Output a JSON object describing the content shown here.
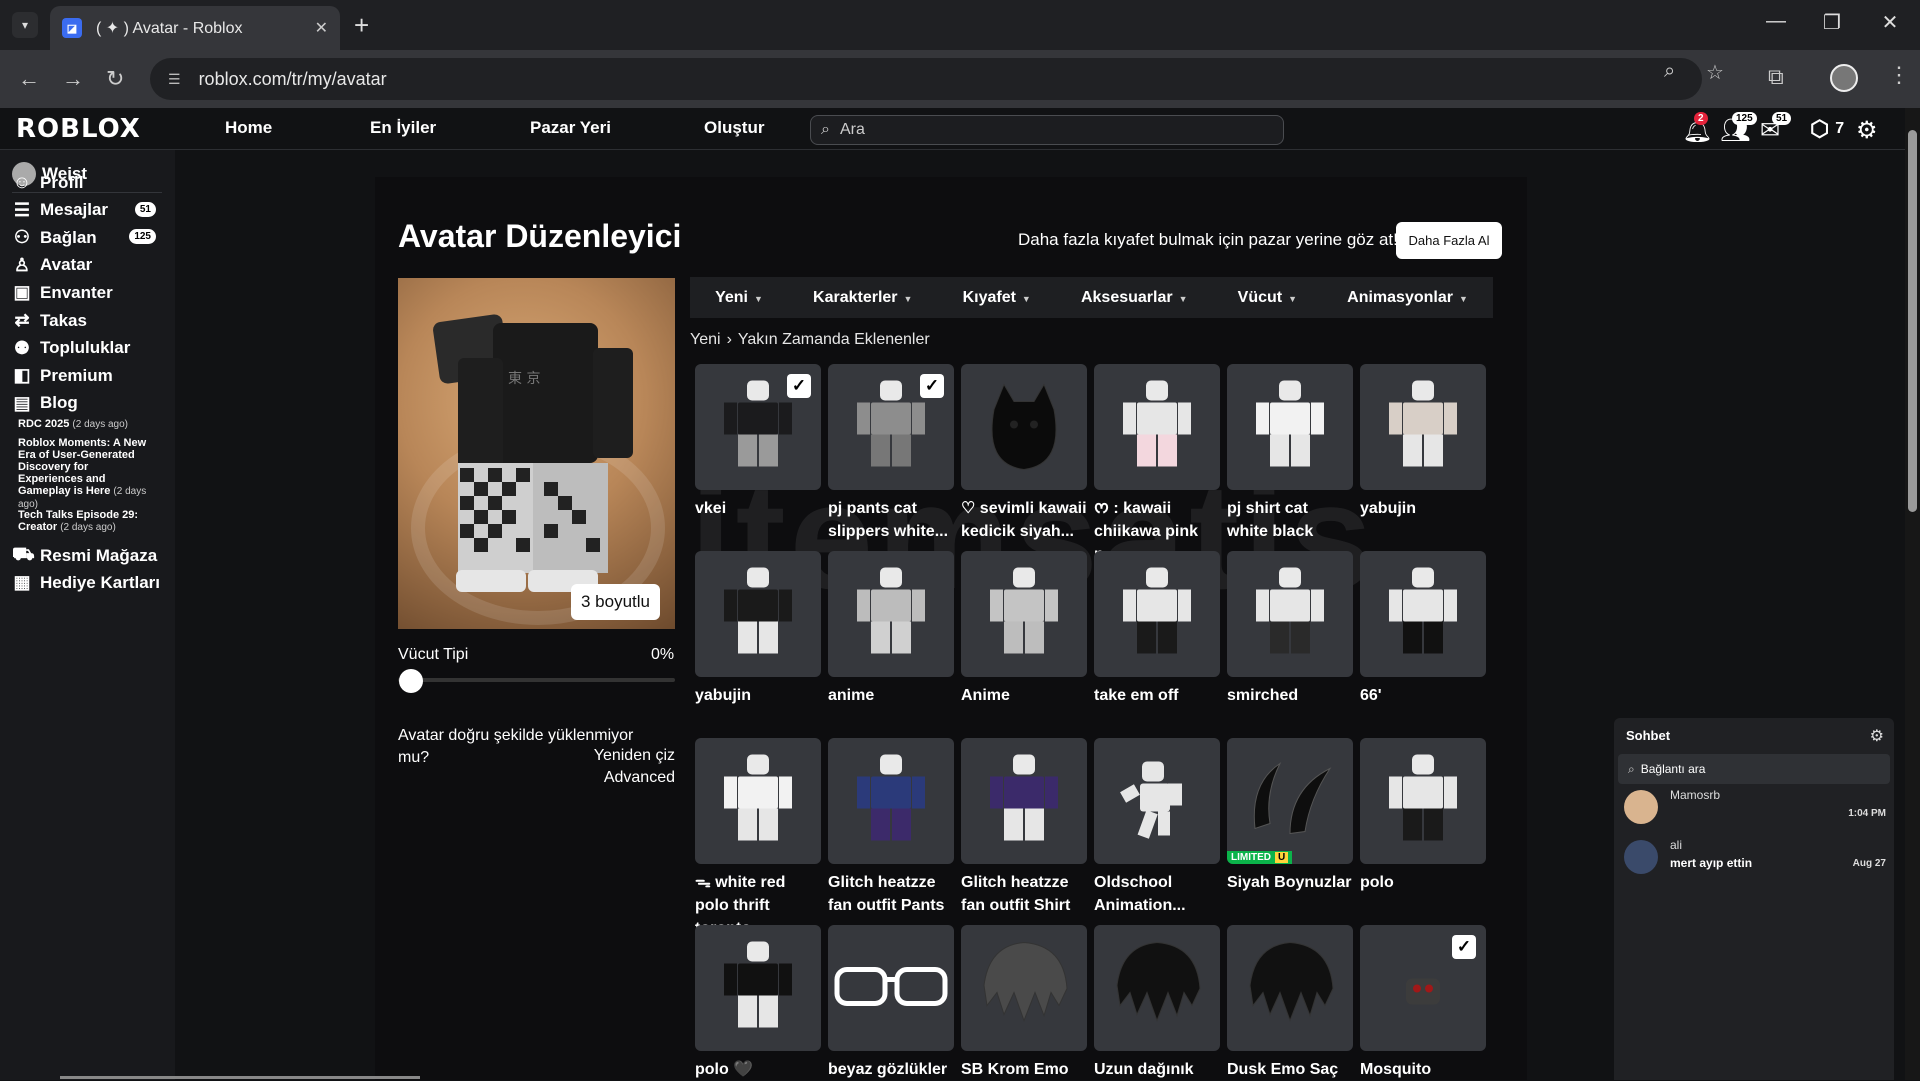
{
  "browser": {
    "tab_title": "( ✦ ) Avatar - Roblox",
    "url": "roblox.com/tr/my/avatar"
  },
  "header": {
    "logo": "ROBLOX",
    "nav": [
      "Home",
      "En İyiler",
      "Pazar Yeri",
      "Oluştur"
    ],
    "search_placeholder": "Ara",
    "notif_badge": "2",
    "friends_badge": "125",
    "messages_badge": "51",
    "robux": "7"
  },
  "sidebar": {
    "username": "Weist",
    "items": [
      {
        "label": "Profil",
        "icon": "person-icon",
        "badge": ""
      },
      {
        "label": "Mesajlar",
        "icon": "messages-icon",
        "badge": "51"
      },
      {
        "label": "Bağlan",
        "icon": "friends-icon",
        "badge": "125"
      },
      {
        "label": "Avatar",
        "icon": "avatar-icon",
        "badge": ""
      },
      {
        "label": "Envanter",
        "icon": "inventory-icon",
        "badge": ""
      },
      {
        "label": "Takas",
        "icon": "trade-icon",
        "badge": ""
      },
      {
        "label": "Topluluklar",
        "icon": "groups-icon",
        "badge": ""
      },
      {
        "label": "Premium",
        "icon": "premium-icon",
        "badge": ""
      },
      {
        "label": "Blog",
        "icon": "blog-icon",
        "badge": ""
      }
    ],
    "blog_posts": [
      {
        "title": "RDC 2025",
        "ago": "(2 days ago)"
      },
      {
        "title": "Roblox Moments: A New Era of User-Generated Discovery for Experiences and Gameplay is Here",
        "ago": "(2 days ago)"
      },
      {
        "title": "Tech Talks Episode 29: Creator",
        "ago": "(2 days ago)"
      }
    ],
    "bottom_items": [
      {
        "label": "Resmi Mağaza",
        "icon": "cart-icon"
      },
      {
        "label": "Hediye Kartları",
        "icon": "gift-card-icon"
      }
    ]
  },
  "editor": {
    "title": "Avatar Düzenleyici",
    "promo": "Daha fazla kıyafet bulmak için pazar yerine göz at!",
    "more_button": "Daha Fazla Al",
    "view_3d_button": "3 boyutlu",
    "body_type_label": "Vücut Tipi",
    "body_type_value": "0%",
    "body_type_level": 0,
    "help_text": "Avatar doğru şekilde yüklenmiyor mu?",
    "redraw": "Yeniden çiz",
    "advanced": "Advanced",
    "tabs": [
      "Yeni",
      "Karakterler",
      "Kıyafet",
      "Aksesuarlar",
      "Vücut",
      "Animasyonlar"
    ],
    "breadcrumb": [
      "Yeni",
      "Yakın Zamanda Eklenenler"
    ],
    "items": [
      {
        "name": "vkei",
        "checked": true,
        "kind": "fig",
        "top": "#1b1b1d",
        "bottom": "#9a9a9a"
      },
      {
        "name": "pj pants cat slippers white...",
        "checked": true,
        "kind": "fig",
        "top": "#8d8d8d",
        "bottom": "#777"
      },
      {
        "name": "♡ sevimli kawaii kedicik siyah...",
        "checked": false,
        "kind": "bag",
        "top": "#111",
        "bottom": "#111"
      },
      {
        "name": "ᰔ : kawaii chiikawa pink p...",
        "checked": false,
        "kind": "fig",
        "top": "#e6e6e6",
        "bottom": "#f3d7de"
      },
      {
        "name": "pj shirt cat white black",
        "checked": false,
        "kind": "fig",
        "top": "#f2f2f2",
        "bottom": "#e6e6e6"
      },
      {
        "name": "yabujin",
        "checked": false,
        "kind": "fig",
        "top": "#d8cfc7",
        "bottom": "#e6e6e6"
      },
      {
        "name": "yabujin",
        "checked": false,
        "kind": "fig",
        "top": "#1a1a1a",
        "bottom": "#e6e6e6"
      },
      {
        "name": "anime",
        "checked": false,
        "kind": "fig",
        "top": "#bcbcbc",
        "bottom": "#d0d0d0"
      },
      {
        "name": "Anime",
        "checked": false,
        "kind": "fig",
        "top": "#c4c4c4",
        "bottom": "#bdbdbd"
      },
      {
        "name": "take em off",
        "checked": false,
        "kind": "fig",
        "top": "#e6e6e6",
        "bottom": "#1a1a1a"
      },
      {
        "name": "smirched",
        "checked": false,
        "kind": "fig",
        "top": "#e6e6e6",
        "bottom": "#2a2a2a"
      },
      {
        "name": "66'",
        "checked": false,
        "kind": "fig",
        "top": "#e6e6e6",
        "bottom": "#111"
      },
      {
        "name": "ᯓ white red polo thrift toronto...",
        "checked": false,
        "kind": "fig",
        "top": "#f2f2f2",
        "bottom": "#e6e6e6"
      },
      {
        "name": "Glitch heatzze fan outfit Pants",
        "checked": false,
        "kind": "fig",
        "top": "#2b3a7a",
        "bottom": "#3c2a6a"
      },
      {
        "name": "Glitch heatzze fan outfit Shirt",
        "checked": false,
        "kind": "fig",
        "top": "#3b2a6a",
        "bottom": "#e6e6e6"
      },
      {
        "name": "Oldschool Animation...",
        "checked": false,
        "kind": "pose",
        "top": "#e6e6e6",
        "bottom": "#e6e6e6"
      },
      {
        "name": "Siyah Boynuzlar",
        "checked": false,
        "kind": "horns",
        "top": "#111",
        "bottom": "#111",
        "limited": "LIMITED",
        "limited_u": "U"
      },
      {
        "name": "polo",
        "checked": false,
        "kind": "fig",
        "top": "#e6e6e6",
        "bottom": "#1a1a1a"
      },
      {
        "name": "polo 🖤",
        "checked": false,
        "kind": "fig",
        "top": "#111",
        "bottom": "#e6e6e6"
      },
      {
        "name": "beyaz gözlükler",
        "checked": false,
        "kind": "glasses",
        "top": "#fff",
        "bottom": "#fff"
      },
      {
        "name": "SB Krom Emo",
        "checked": false,
        "kind": "hair",
        "top": "#4a4a4a",
        "bottom": "#4a4a4a"
      },
      {
        "name": "Uzun dağınık",
        "checked": false,
        "kind": "hair",
        "top": "#111",
        "bottom": "#111"
      },
      {
        "name": "Dusk Emo Saç",
        "checked": false,
        "kind": "hair",
        "top": "#111",
        "bottom": "#111"
      },
      {
        "name": "Mosquito",
        "checked": true,
        "kind": "mask",
        "top": "#444",
        "bottom": "#444"
      }
    ]
  },
  "watermark": "itemsatis",
  "chat": {
    "title": "Sohbet",
    "search_placeholder": "Bağlantı ara",
    "conversations": [
      {
        "name": "Mamosrb",
        "message": "",
        "time": "1:04 PM"
      },
      {
        "name": "ali",
        "message": "mert ayıp ettin",
        "time": "Aug 27"
      }
    ]
  }
}
